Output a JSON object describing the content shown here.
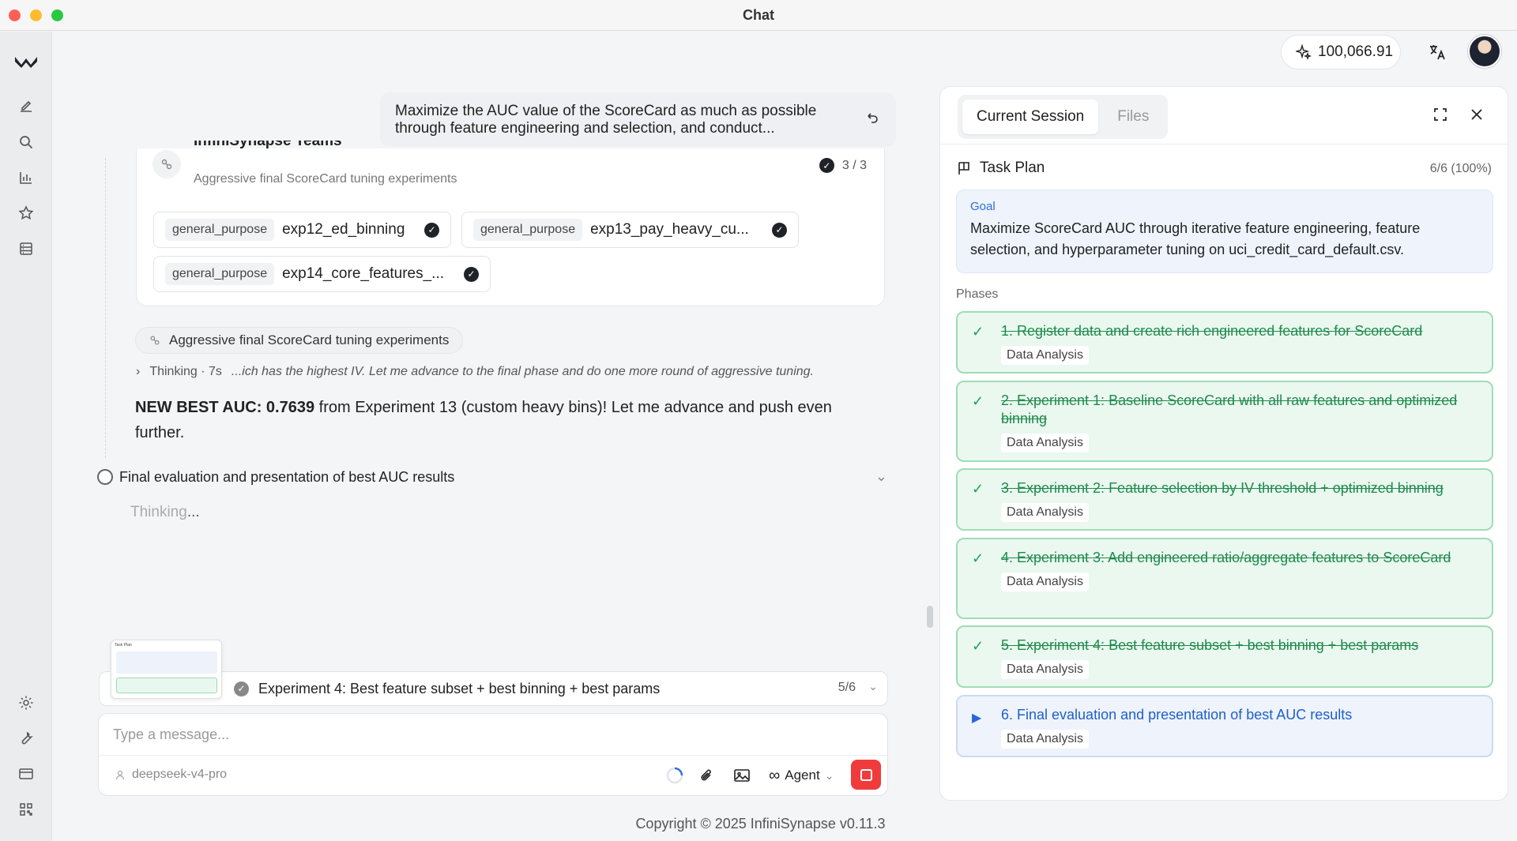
{
  "window": {
    "title": "Chat"
  },
  "topbar": {
    "credits": "100,066.91"
  },
  "chat": {
    "user_message": "Maximize the AUC value of the ScoreCard as much as possible through feature engineering and selection, and conduct...",
    "team": {
      "title": "InfiniSynapse Teams",
      "subtitle": "Aggressive final ScoreCard tuning experiments",
      "count": "3 / 3",
      "agents": [
        {
          "tag": "general_purpose",
          "name": "exp12_ed_binning"
        },
        {
          "tag": "general_purpose",
          "name": "exp13_pay_heavy_cu..."
        },
        {
          "tag": "general_purpose",
          "name": "exp14_core_features_..."
        }
      ]
    },
    "status_pill": "Aggressive final ScoreCard tuning experiments",
    "thinking": {
      "label": "Thinking · 7s",
      "text": "...ich has the highest IV. Let me advance to the final phase and do one more round of aggressive tuning."
    },
    "best": {
      "bold": "NEW BEST AUC: 0.7639",
      "rest": " from Experiment 13 (custom heavy bins)! Let me advance and push even further."
    },
    "final_step": "Final evaluation and presentation of best AUC results",
    "thinking_placeholder": "Thinking",
    "thinking_dots": "..."
  },
  "progress": {
    "current": "Experiment 4: Best feature subset + best binning + best params",
    "count": "5/6"
  },
  "input": {
    "placeholder": "Type a message...",
    "model": "deepseek-v4-pro",
    "mode": "Agent"
  },
  "footer": {
    "copyright": "Copyright © 2025 InfiniSynapse v0.11.3"
  },
  "panel": {
    "tabs": [
      "Current Session",
      "Files"
    ],
    "plan_title": "Task Plan",
    "plan_progress": "6/6 (100%)",
    "goal_label": "Goal",
    "goal_text": "Maximize ScoreCard AUC through iterative feature engineering, feature selection, and hyperparameter tuning on uci_credit_card_default.csv.",
    "phases_label": "Phases",
    "phases": [
      {
        "title": "1. Register data and create rich engineered features for ScoreCard",
        "label": "Data Analysis",
        "status": "done"
      },
      {
        "title": "2. Experiment 1: Baseline ScoreCard with all raw features and optimized binning",
        "label": "Data Analysis",
        "status": "done"
      },
      {
        "title": "3. Experiment 2: Feature selection by IV threshold + optimized binning",
        "label": "Data Analysis",
        "status": "done"
      },
      {
        "title": "4. Experiment 3: Add engineered ratio/aggregate features to ScoreCard",
        "label": "Data Analysis",
        "status": "done"
      },
      {
        "title": "5. Experiment 4: Best feature subset + best binning + best params",
        "label": "Data Analysis",
        "status": "done"
      },
      {
        "title": "6. Final evaluation and presentation of best AUC results",
        "label": "Data Analysis",
        "status": "active"
      }
    ]
  },
  "thumbnail": {
    "title": "Task Plan"
  }
}
